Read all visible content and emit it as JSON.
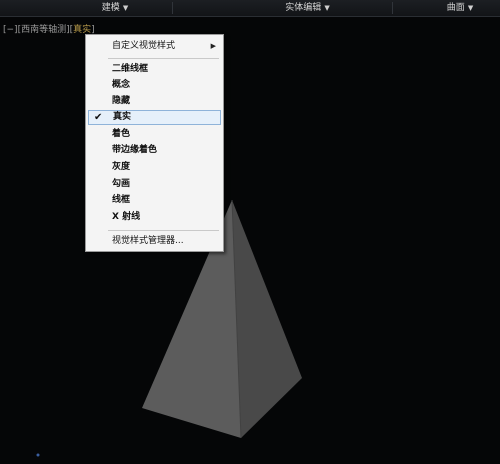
{
  "ribbon": {
    "tabs": [
      {
        "label": "建模"
      },
      {
        "label": "实体编辑"
      },
      {
        "label": "曲面"
      }
    ],
    "dropdown_icon": "caret-down-icon"
  },
  "viewport": {
    "prefix": "[−][",
    "view": "西南等轴测",
    "mid": "][",
    "style": "真实",
    "suffix": "]"
  },
  "context_menu": {
    "custom_styles_label": "自定义视觉样式",
    "items": [
      {
        "label": "二维线框",
        "checked": false
      },
      {
        "label": "概念",
        "checked": false
      },
      {
        "label": "隐藏",
        "checked": false
      },
      {
        "label": "真实",
        "checked": true
      },
      {
        "label": "着色",
        "checked": false
      },
      {
        "label": "带边缘着色",
        "checked": false
      },
      {
        "label": "灰度",
        "checked": false
      },
      {
        "label": "勾画",
        "checked": false
      },
      {
        "label": "线框",
        "checked": false
      },
      {
        "label": "X 射线",
        "checked": false
      }
    ],
    "manager_label": "视觉样式管理器...",
    "check_icon": "checkmark-icon",
    "submenu_icon": "chevron-right-icon"
  },
  "colors": {
    "background": "#050607",
    "pyramid_left_face": "#5b5b5b",
    "pyramid_right_face": "#4a4a4a",
    "menu_highlight": "#e6f0fa"
  }
}
